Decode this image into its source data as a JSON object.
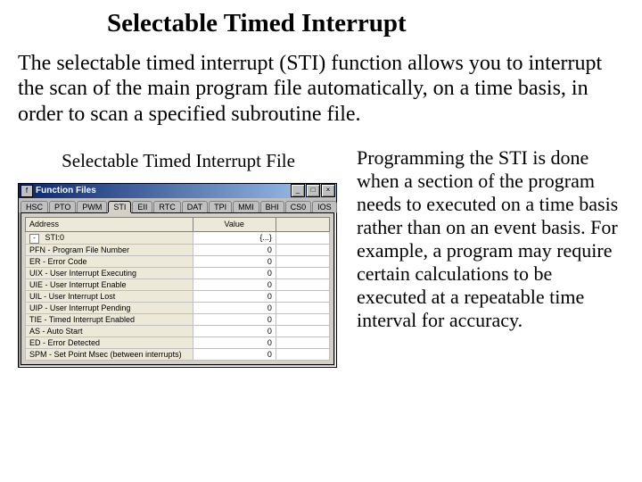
{
  "title": "Selectable Timed Interrupt",
  "intro": "The selectable timed interrupt (STI) function allows you to interrupt the scan of the main program file automatically, on a time basis, in order to scan a specified subroutine file.",
  "caption": "Selectable Timed Interrupt File",
  "right_text": "Programming the STI is done when a section of the program needs to executed on a time basis rather than on an event basis. For example, a program may require certain calculations to be executed at a repeatable time interval for accuracy.",
  "window": {
    "title": "Function Files",
    "tabs": [
      "HSC",
      "PTO",
      "PWM",
      "STI",
      "EII",
      "RTC",
      "DAT",
      "TPI",
      "MMI",
      "BHI",
      "CS0",
      "IOS"
    ],
    "active_tab_index": 3,
    "headers": [
      "Address",
      "Value",
      ""
    ],
    "group": {
      "label": "STI:0",
      "group_value": "{...}"
    },
    "rows": [
      {
        "addr": "PFN - Program File Number",
        "val": "0"
      },
      {
        "addr": "ER - Error Code",
        "val": "0"
      },
      {
        "addr": "UIX - User Interrupt Executing",
        "val": "0"
      },
      {
        "addr": "UIE - User Interrupt Enable",
        "val": "0"
      },
      {
        "addr": "UIL - User Interrupt Lost",
        "val": "0"
      },
      {
        "addr": "UIP - User Interrupt Pending",
        "val": "0"
      },
      {
        "addr": "TIE - Timed Interrupt Enabled",
        "val": "0"
      },
      {
        "addr": "AS - Auto Start",
        "val": "0"
      },
      {
        "addr": "ED - Error Detected",
        "val": "0"
      },
      {
        "addr": "SPM - Set Point Msec (between interrupts)",
        "val": "0"
      }
    ]
  }
}
